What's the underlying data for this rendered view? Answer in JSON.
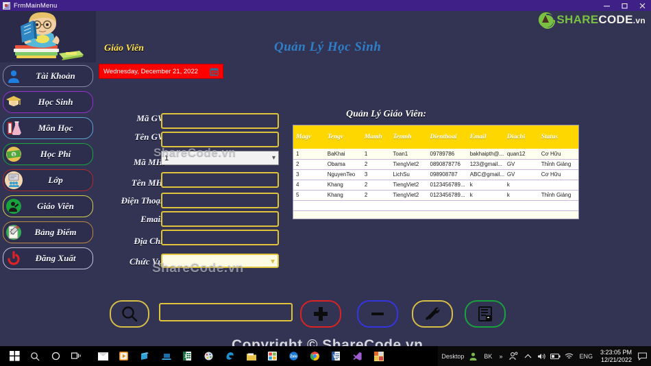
{
  "window": {
    "title": "FrmMainMenu",
    "minimize": "minimize-button",
    "maximize": "maximize-button",
    "close": "close-button"
  },
  "brand": {
    "share": "SHARE",
    "code": "CODE",
    "tld": ".vn"
  },
  "header": {
    "section_title": "Giáo Viên",
    "date_text": "Wednesday, December 21, 2022",
    "app_title": "Quản Lý Học Sinh"
  },
  "sidebar": {
    "items": [
      {
        "label": "Tài Khoản",
        "icon": "user-icon",
        "border": "#8a8aa8",
        "accent": "#1f7fe0"
      },
      {
        "label": "Học Sinh",
        "icon": "graduate-icon",
        "border": "#9a2fd0",
        "accent": "#e8c251"
      },
      {
        "label": "Môn Học",
        "icon": "flask-icon",
        "border": "#5aa8d8",
        "accent": "#e8a5c0"
      },
      {
        "label": "Học Phí",
        "icon": "money-icon",
        "border": "#17a83e",
        "accent": "#4fa83e"
      },
      {
        "label": "Lớp",
        "icon": "classroom-icon",
        "border": "#b02b2b",
        "accent": "#f0d2a8"
      },
      {
        "label": "Giáo Viên",
        "icon": "teacher-icon",
        "border": "#d9d44a",
        "accent": "#19a33c"
      },
      {
        "label": "Bảng Điểm",
        "icon": "report-icon",
        "border": "#c08a3e",
        "accent": "#2fb055"
      },
      {
        "label": "Đăng Xuất",
        "icon": "power-icon",
        "border": "#c8c8e0",
        "accent": "#e02222"
      }
    ]
  },
  "form": {
    "fields": [
      {
        "label": "Mã GV:",
        "type": "text",
        "value": ""
      },
      {
        "label": "Tên GV:",
        "type": "text",
        "value": ""
      },
      {
        "label": "Mã MH:",
        "type": "combo",
        "value": "1"
      },
      {
        "label": "Tên MH:",
        "type": "text",
        "value": ""
      },
      {
        "label": "Điện Thoại:",
        "type": "text",
        "value": ""
      },
      {
        "label": "Email:",
        "type": "text",
        "value": ""
      },
      {
        "label": "Địa Chỉ:",
        "type": "text",
        "value": ""
      },
      {
        "label": "Chức Vụ:",
        "type": "combo-gold",
        "value": ""
      }
    ]
  },
  "grid": {
    "title": "Quản Lý Giáo Viên:",
    "columns": [
      "Magv",
      "Tengv",
      "Mamh",
      "Tenmh",
      "Dienthoai",
      "Email",
      "Diachi",
      "Status"
    ],
    "rows": [
      [
        "1",
        "BaKhai",
        "1",
        "Toan1",
        "09789786",
        "bakhaipth@...",
        "quan12",
        "Cơ Hữu"
      ],
      [
        "2",
        "Obama",
        "2",
        "TiengViet2",
        "0890878776",
        "123@gmail...",
        "GV",
        "Thỉnh Giảng"
      ],
      [
        "3",
        "NguyenTeo",
        "3",
        "LichSu",
        "098908787",
        "ABC@gmail...",
        "GV",
        "Cơ Hữu"
      ],
      [
        "4",
        "Khang",
        "2",
        "TiengViet2",
        "0123456789...",
        "k",
        "k",
        ""
      ],
      [
        "5",
        "Khang",
        "2",
        "TiengViet2",
        "0123456789...",
        "k",
        "k",
        "Thỉnh Giảng"
      ]
    ]
  },
  "actions": {
    "search": "search-icon",
    "search_value": "",
    "add": "plus-icon",
    "delete": "minus-icon",
    "edit": "tools-icon",
    "save": "save-disk-icon"
  },
  "watermarks": {
    "one": "ShareCode.vn",
    "two": "ShareCode.vn",
    "copyright": "Copyright © ShareCode.vn"
  },
  "taskbar": {
    "desktop_label": "Desktop",
    "user_label": "BK",
    "overflow": "»",
    "language": "ENG",
    "time": "3:23:05 PM",
    "date": "12/21/2022"
  },
  "colors": {
    "background": "#333354",
    "titlebar": "#3F2087",
    "gold": "#e0c43a",
    "grid_header": "#ffd700",
    "date_red": "#fc0000",
    "title_blue": "#2f7fc8",
    "brand_green": "#7ac143"
  }
}
